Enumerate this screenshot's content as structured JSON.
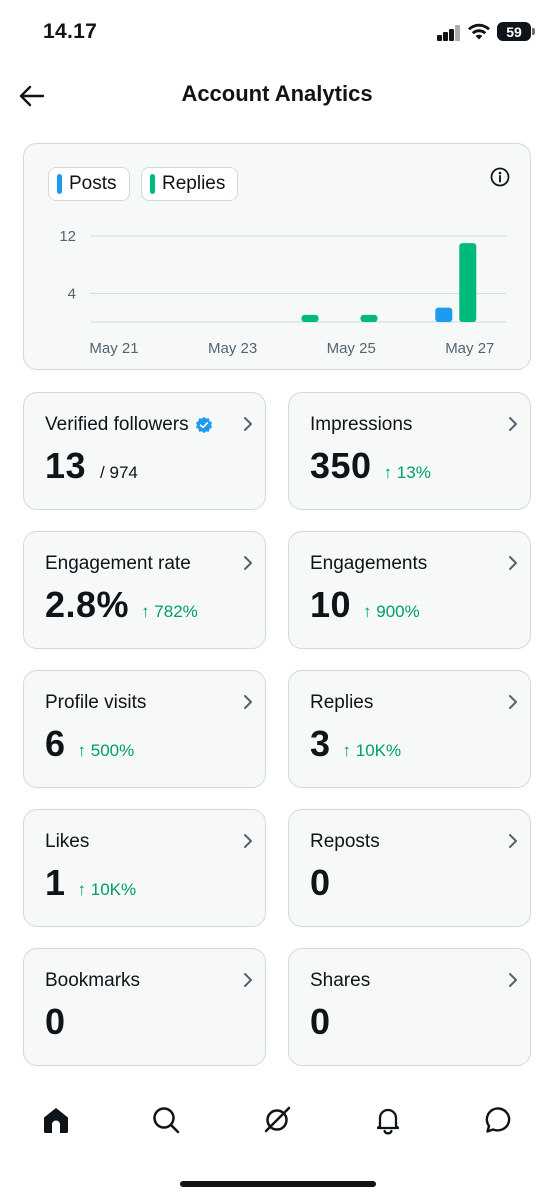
{
  "status_bar": {
    "time": "14.17",
    "battery": "59"
  },
  "header": {
    "title": "Account Analytics"
  },
  "chart_data": {
    "type": "bar",
    "legend": [
      {
        "name": "Posts",
        "color": "#1d9bf0"
      },
      {
        "name": "Replies",
        "color": "#00ba7c"
      }
    ],
    "x_tick_labels": [
      "May 21",
      "May 23",
      "May 25",
      "May 27"
    ],
    "y_ticks": [
      12,
      4
    ],
    "ylim": [
      0,
      13
    ],
    "grid": true,
    "series": [
      {
        "name": "Posts",
        "points": [
          {
            "x": "May 27",
            "value": 2
          }
        ]
      },
      {
        "name": "Replies",
        "points": [
          {
            "x": "May 24",
            "value": 1
          },
          {
            "x": "May 25",
            "value": 1
          },
          {
            "x": "May 27",
            "value": 11
          }
        ]
      }
    ]
  },
  "stats": [
    {
      "label": "Verified followers",
      "value": "13",
      "sub": "/ 974",
      "change": "",
      "verified": true
    },
    {
      "label": "Impressions",
      "value": "350",
      "sub": "",
      "change": "↑ 13%"
    },
    {
      "label": "Engagement rate",
      "value": "2.8%",
      "sub": "",
      "change": "↑ 782%"
    },
    {
      "label": "Engagements",
      "value": "10",
      "sub": "",
      "change": "↑ 900%"
    },
    {
      "label": "Profile visits",
      "value": "6",
      "sub": "",
      "change": "↑ 500%"
    },
    {
      "label": "Replies",
      "value": "3",
      "sub": "",
      "change": "↑ 10K%"
    },
    {
      "label": "Likes",
      "value": "1",
      "sub": "",
      "change": "↑ 10K%"
    },
    {
      "label": "Reposts",
      "value": "0",
      "sub": "",
      "change": ""
    },
    {
      "label": "Bookmarks",
      "value": "0",
      "sub": "",
      "change": ""
    },
    {
      "label": "Shares",
      "value": "0",
      "sub": "",
      "change": ""
    }
  ],
  "nav": {
    "items": [
      {
        "icon": "home-icon",
        "active": true
      },
      {
        "icon": "search-icon"
      },
      {
        "icon": "grok-icon"
      },
      {
        "icon": "bell-icon"
      },
      {
        "icon": "chat-bubble-icon"
      }
    ]
  }
}
